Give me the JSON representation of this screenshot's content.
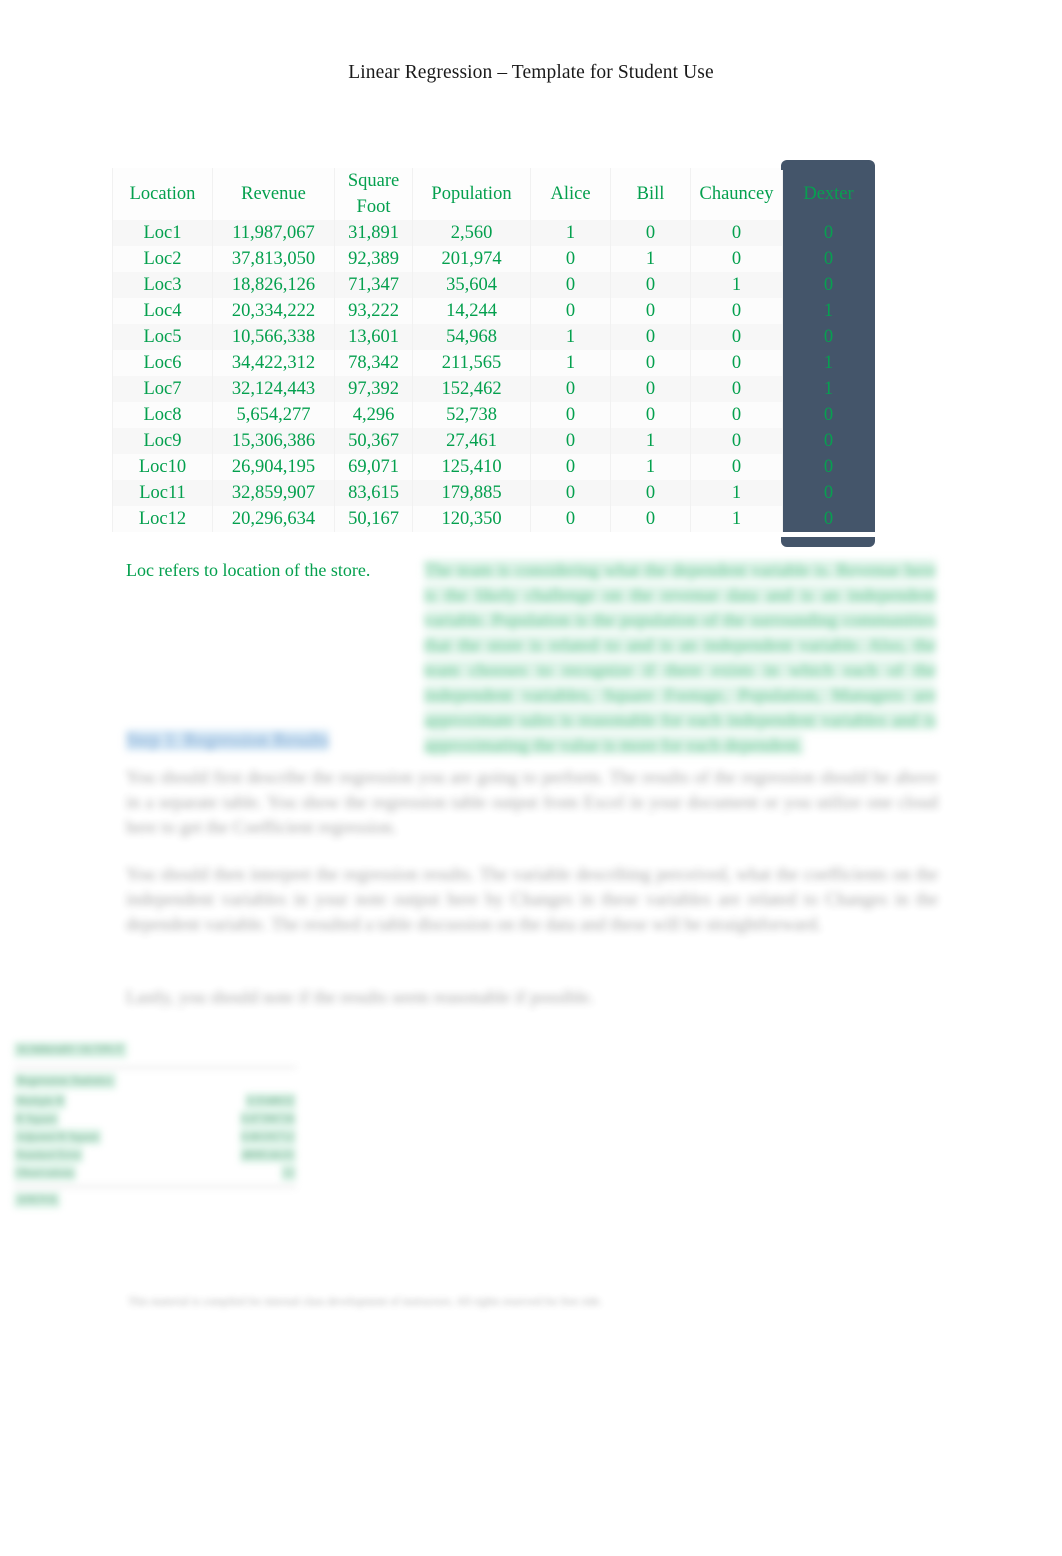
{
  "document": {
    "title": "Linear Regression – Template for Student Use"
  },
  "table": {
    "headers": [
      "Location",
      "Revenue",
      "Square Foot",
      "Population",
      "Alice",
      "Bill",
      "Chauncey",
      "Dexter"
    ],
    "selected_column": "Dexter",
    "selection_color": "#44556a",
    "text_color": "#04a04e",
    "rows": [
      {
        "location": "Loc1",
        "revenue": "11,987,067",
        "square_foot": "31,891",
        "population": "2,560",
        "alice": "1",
        "bill": "0",
        "chauncey": "0",
        "dexter": "0"
      },
      {
        "location": "Loc2",
        "revenue": "37,813,050",
        "square_foot": "92,389",
        "population": "201,974",
        "alice": "0",
        "bill": "1",
        "chauncey": "0",
        "dexter": "0"
      },
      {
        "location": "Loc3",
        "revenue": "18,826,126",
        "square_foot": "71,347",
        "population": "35,604",
        "alice": "0",
        "bill": "0",
        "chauncey": "1",
        "dexter": "0"
      },
      {
        "location": "Loc4",
        "revenue": "20,334,222",
        "square_foot": "93,222",
        "population": "14,244",
        "alice": "0",
        "bill": "0",
        "chauncey": "0",
        "dexter": "1"
      },
      {
        "location": "Loc5",
        "revenue": "10,566,338",
        "square_foot": "13,601",
        "population": "54,968",
        "alice": "1",
        "bill": "0",
        "chauncey": "0",
        "dexter": "0"
      },
      {
        "location": "Loc6",
        "revenue": "34,422,312",
        "square_foot": "78,342",
        "population": "211,565",
        "alice": "1",
        "bill": "0",
        "chauncey": "0",
        "dexter": "1"
      },
      {
        "location": "Loc7",
        "revenue": "32,124,443",
        "square_foot": "97,392",
        "population": "152,462",
        "alice": "0",
        "bill": "0",
        "chauncey": "0",
        "dexter": "1"
      },
      {
        "location": "Loc8",
        "revenue": "5,654,277",
        "square_foot": "4,296",
        "population": "52,738",
        "alice": "0",
        "bill": "0",
        "chauncey": "0",
        "dexter": "0"
      },
      {
        "location": "Loc9",
        "revenue": "15,306,386",
        "square_foot": "50,367",
        "population": "27,461",
        "alice": "0",
        "bill": "1",
        "chauncey": "0",
        "dexter": "0"
      },
      {
        "location": "Loc10",
        "revenue": "26,904,195",
        "square_foot": "69,071",
        "population": "125,410",
        "alice": "0",
        "bill": "1",
        "chauncey": "0",
        "dexter": "0"
      },
      {
        "location": "Loc11",
        "revenue": "32,859,907",
        "square_foot": "83,615",
        "population": "179,885",
        "alice": "0",
        "bill": "0",
        "chauncey": "1",
        "dexter": "0"
      },
      {
        "location": "Loc12",
        "revenue": "20,296,634",
        "square_foot": "50,167",
        "population": "120,350",
        "alice": "0",
        "bill": "0",
        "chauncey": "1",
        "dexter": "0"
      }
    ]
  },
  "body": {
    "caption_legible": "Loc refers to location of the store.",
    "caption_highlighted_blurred": "The team is considering what the dependent variable is. Revenue here is the likely challenge on the revenue data and is an independent variable. Population is the population of the surrounding communities that the store is related to and is an independent variable. Also, the team chooses to recognize if there exists in which each of the independent variables, Square Footage, Population, Managers are approximate sales is reasonable for each independent variables and is approximating the value is more for each dependent.",
    "section_heading_blurred": "Step 1: Regression Results",
    "paragraph_1_blurred": "You should first describe the regression you are going to perform. The results of the regression should be above in a separate table. You show the regression table output from Excel in your document or you utilize one cloud here to get the Coefficient regression.",
    "paragraph_2_blurred": "You should then interpret the regression results. The variable describing perceived, what the coefficients on the independent variables in your note output here by Changes in these variables are related to Changes in the dependent variable. The resulted a table discussion on the data and these will be straightforward.",
    "paragraph_3_blurred": "Lastly, you should note if the results seem reasonable if possible.",
    "footer_blurred": "This material is compiled for internal class development of instructors. All rights reserved for free ride."
  },
  "stats_output": {
    "title_blurred": "SUMMARY OUTPUT",
    "section_label_blurred": "Regression Statistics",
    "rows": [
      {
        "label": "Multiple R",
        "value": "0.9348632"
      },
      {
        "label": "R Square",
        "value": "0.87396726"
      },
      {
        "label": "Adjusted R Square",
        "value": "0.80195712"
      },
      {
        "label": "Standard Error",
        "value": "4808144.01"
      },
      {
        "label": "Observations",
        "value": "12"
      }
    ],
    "anova_label_blurred": "ANOVA"
  }
}
